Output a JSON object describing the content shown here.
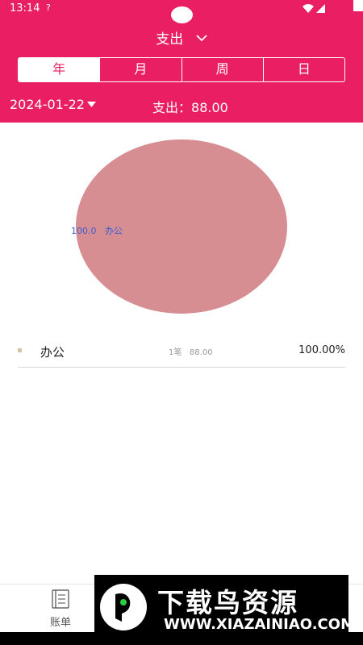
{
  "status_bar": {
    "time": "13:14",
    "sim_label": "?"
  },
  "header": {
    "type_label": "支出",
    "period_tabs": [
      {
        "label": "年",
        "active": true
      },
      {
        "label": "月",
        "active": false
      },
      {
        "label": "周",
        "active": false
      },
      {
        "label": "日",
        "active": false
      }
    ],
    "date": "2024-01-22",
    "summary_label": "支出：",
    "summary_value": "88.00",
    "accent_color": "#e91e63"
  },
  "chart_data": {
    "type": "pie",
    "categories": [
      "办公"
    ],
    "values": [
      100.0
    ],
    "slice_labels": [
      {
        "value": "100.0",
        "name": "办公"
      }
    ],
    "colors": [
      "#d68e92"
    ]
  },
  "legend": [
    {
      "name": "办公",
      "count": "1笔",
      "amount": "88.00",
      "percent": "100.00%",
      "color": "#d5c3a2"
    }
  ],
  "bottom_nav": [
    {
      "label": "账单",
      "icon": "ledger-icon"
    }
  ],
  "watermark": {
    "title": "下载鸟资源",
    "url": "WWW.XIAZAINIAO.COM"
  }
}
